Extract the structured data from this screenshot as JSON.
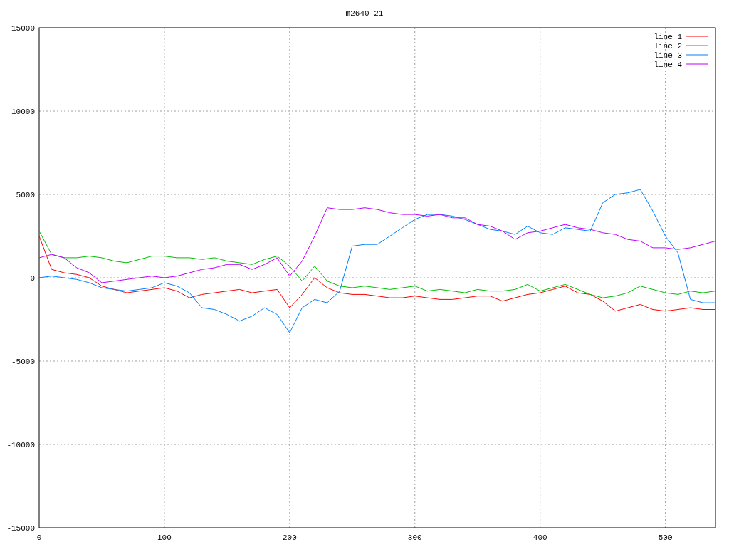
{
  "chart_data": {
    "type": "line",
    "title": "m2640_21",
    "x": [
      0,
      10,
      20,
      30,
      40,
      50,
      60,
      70,
      80,
      90,
      100,
      110,
      120,
      130,
      140,
      150,
      160,
      170,
      180,
      190,
      200,
      210,
      220,
      230,
      240,
      250,
      260,
      270,
      280,
      290,
      300,
      310,
      320,
      330,
      340,
      350,
      360,
      370,
      380,
      390,
      400,
      410,
      420,
      430,
      440,
      450,
      460,
      470,
      480,
      490,
      500,
      510,
      520,
      530,
      540
    ],
    "series": [
      {
        "name": "line 1",
        "color": "#ff0000",
        "values": [
          2500,
          500,
          300,
          200,
          0,
          -500,
          -700,
          -900,
          -800,
          -700,
          -600,
          -800,
          -1200,
          -1000,
          -900,
          -800,
          -700,
          -900,
          -800,
          -700,
          -1800,
          -1000,
          0,
          -600,
          -900,
          -1000,
          -1000,
          -1100,
          -1200,
          -1200,
          -1100,
          -1200,
          -1300,
          -1300,
          -1200,
          -1100,
          -1100,
          -1400,
          -1200,
          -1000,
          -900,
          -700,
          -500,
          -900,
          -1000,
          -1400,
          -2000,
          -1800,
          -1600,
          -1900,
          -2000,
          -1900,
          -1800,
          -1900,
          -1900
        ]
      },
      {
        "name": "line 2",
        "color": "#00c000",
        "values": [
          2800,
          1400,
          1200,
          1200,
          1300,
          1200,
          1000,
          900,
          1100,
          1300,
          1300,
          1200,
          1200,
          1100,
          1200,
          1000,
          900,
          800,
          1100,
          1300,
          700,
          -200,
          700,
          -200,
          -500,
          -600,
          -500,
          -600,
          -700,
          -600,
          -500,
          -800,
          -700,
          -800,
          -900,
          -700,
          -800,
          -800,
          -700,
          -400,
          -800,
          -600,
          -400,
          -700,
          -1000,
          -1200,
          -1100,
          -900,
          -500,
          -700,
          -900,
          -1000,
          -800,
          -900,
          -800
        ]
      },
      {
        "name": "line 3",
        "color": "#0080ff",
        "values": [
          0,
          100,
          0,
          -100,
          -300,
          -600,
          -700,
          -800,
          -700,
          -600,
          -300,
          -500,
          -900,
          -1800,
          -1900,
          -2200,
          -2600,
          -2300,
          -1800,
          -2200,
          -3300,
          -1800,
          -1300,
          -1500,
          -800,
          1900,
          2000,
          2000,
          2500,
          3000,
          3500,
          3800,
          3800,
          3700,
          3500,
          3200,
          2900,
          2800,
          2600,
          3100,
          2700,
          2600,
          3000,
          2900,
          2800,
          4500,
          5000,
          5100,
          5300,
          4000,
          2500,
          1500,
          -1300,
          -1500,
          -1500
        ]
      },
      {
        "name": "line 4",
        "color": "#c000ff",
        "values": [
          1200,
          1400,
          1200,
          600,
          300,
          -300,
          -200,
          -100,
          0,
          100,
          0,
          100,
          300,
          500,
          600,
          800,
          800,
          500,
          800,
          1200,
          100,
          1000,
          2500,
          4200,
          4100,
          4100,
          4200,
          4100,
          3900,
          3800,
          3800,
          3700,
          3800,
          3600,
          3600,
          3200,
          3100,
          2800,
          2300,
          2700,
          2800,
          3000,
          3200,
          3000,
          2900,
          2700,
          2600,
          2300,
          2200,
          1800,
          1800,
          1700,
          1800,
          2000,
          2200
        ]
      }
    ],
    "grid": true,
    "legend": true,
    "xlim": [
      0,
      540
    ],
    "ylim": [
      -15000,
      15000
    ],
    "xticks": [
      0,
      100,
      200,
      300,
      400,
      500
    ],
    "yticks": [
      -15000,
      -10000,
      -5000,
      0,
      5000,
      10000,
      15000
    ]
  }
}
